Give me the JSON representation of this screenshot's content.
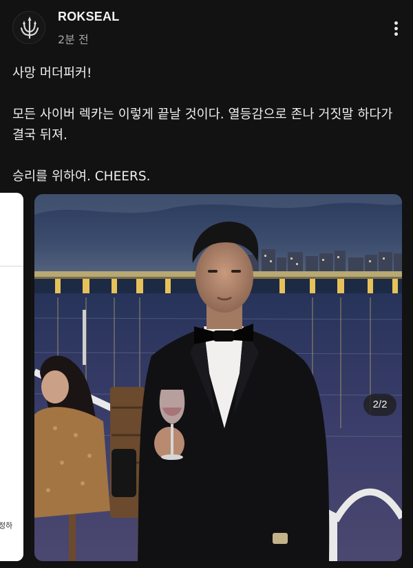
{
  "post": {
    "author": "ROKSEAL",
    "timestamp": "2분 전",
    "more_icon": "more-vertical-icon",
    "avatar_icon": "trident-logo-icon",
    "body_lines": [
      "사망 머더퍼커!",
      "",
      "모든 사이버 렉카는 이렇게 끝날 것이다. 열등감으로 존나 거짓말 하다가 결국 뒤져.",
      "",
      "승리를 위하여. CHEERS."
    ]
  },
  "gallery": {
    "page_indicator": "2/2",
    "current_index": 2,
    "total": 2,
    "prev_card_snippet": "정하"
  },
  "colors": {
    "background": "#121213",
    "text": "#eeeeee",
    "secondary_text": "#a6a6a6",
    "badge_bg": "#1e1e20"
  }
}
